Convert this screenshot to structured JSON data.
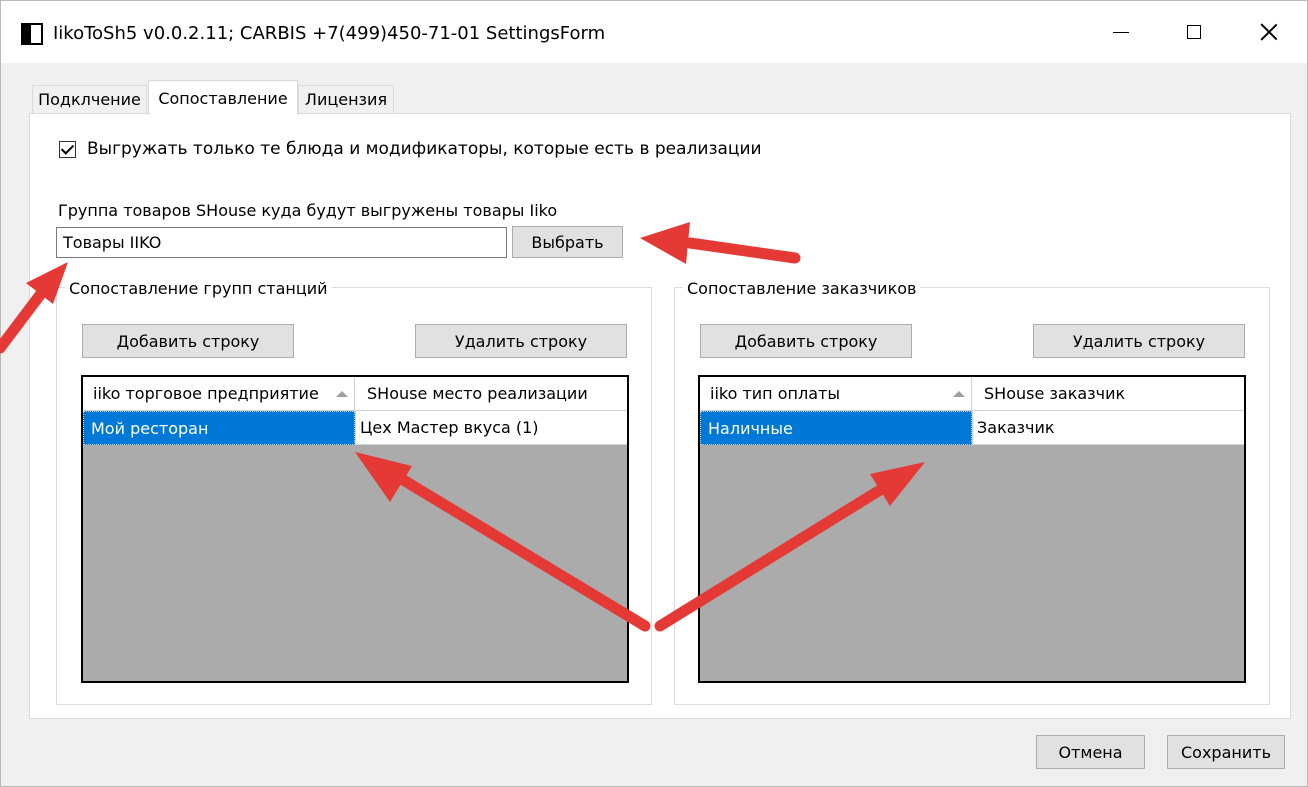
{
  "window": {
    "title": "IikoToSh5 v0.0.2.11;  CARBIS +7(499)450-71-01 SettingsForm"
  },
  "tabs": [
    {
      "label": "Подклчение",
      "active": false
    },
    {
      "label": "Сопоставление",
      "active": true
    },
    {
      "label": "Лицензия",
      "active": false
    }
  ],
  "mapping": {
    "only_sold_checkbox": {
      "label": "Выгружать только те блюда и модификаторы, которые есть в реализации",
      "checked": true
    },
    "goods_group": {
      "label": "Группа товаров SHouse куда будут выгружены товары Iiko",
      "value": "Товары IIKO",
      "select_button": "Выбрать"
    },
    "stations": {
      "title": "Сопоставление групп станций",
      "add_button": "Добавить строку",
      "delete_button": "Удалить строку",
      "columns": [
        "iiko торговое предприятие",
        "SHouse место реализации"
      ],
      "rows": [
        [
          "Мой ресторан",
          "Цех Мастер вкуса (1)"
        ]
      ]
    },
    "customers": {
      "title": "Сопоставление заказчиков",
      "add_button": "Добавить строку",
      "delete_button": "Удалить строку",
      "columns": [
        "iiko тип оплаты",
        "SHouse заказчик"
      ],
      "rows": [
        [
          "Наличные",
          "Заказчик"
        ]
      ]
    }
  },
  "footer": {
    "cancel_label": "Отмена",
    "save_label": "Сохранить"
  },
  "colors": {
    "selection": "#0078d7",
    "annotation_arrow": "#e53935",
    "grid_empty": "#ababab"
  },
  "icons": [
    "app-icon",
    "minimize-icon",
    "maximize-icon",
    "close-icon",
    "checkmark-icon",
    "sort-ascending-icon",
    "annotation-arrow-icon"
  ]
}
